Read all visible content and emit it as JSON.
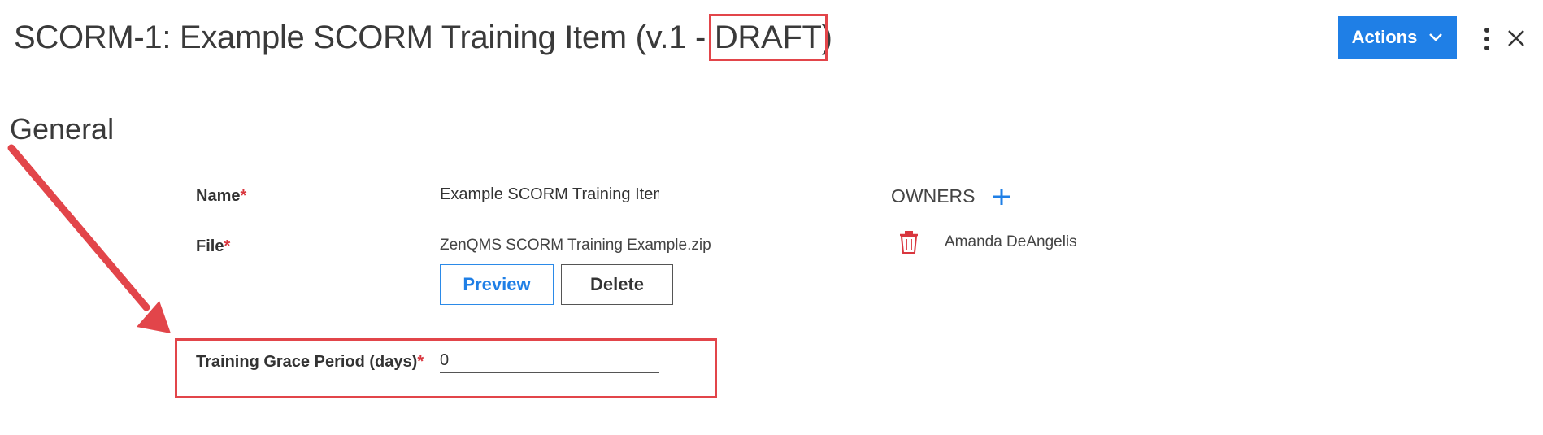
{
  "header": {
    "title_main": "SCORM-1: Example SCORM Training Item (v.1 - ",
    "title_status": "DRAFT",
    "title_end": ")",
    "actions_label": "Actions"
  },
  "section": {
    "title": "General"
  },
  "form": {
    "name_label": "Name",
    "name_value": "Example SCORM Training Item",
    "file_label": "File",
    "file_value": "ZenQMS SCORM Training Example.zip",
    "preview_label": "Preview",
    "delete_label": "Delete",
    "grace_label": "Training Grace Period (days)",
    "grace_value": "0",
    "required_mark": "*"
  },
  "owners": {
    "label": "OWNERS",
    "items": [
      {
        "name": "Amanda DeAngelis"
      }
    ]
  },
  "colors": {
    "accent": "#1f7fe6",
    "annotation": "#e2454a",
    "required": "#d9363e"
  },
  "icons": [
    "chevron-down-icon",
    "kebab-menu-icon",
    "close-icon",
    "plus-icon",
    "trash-icon",
    "annotation-arrow"
  ]
}
